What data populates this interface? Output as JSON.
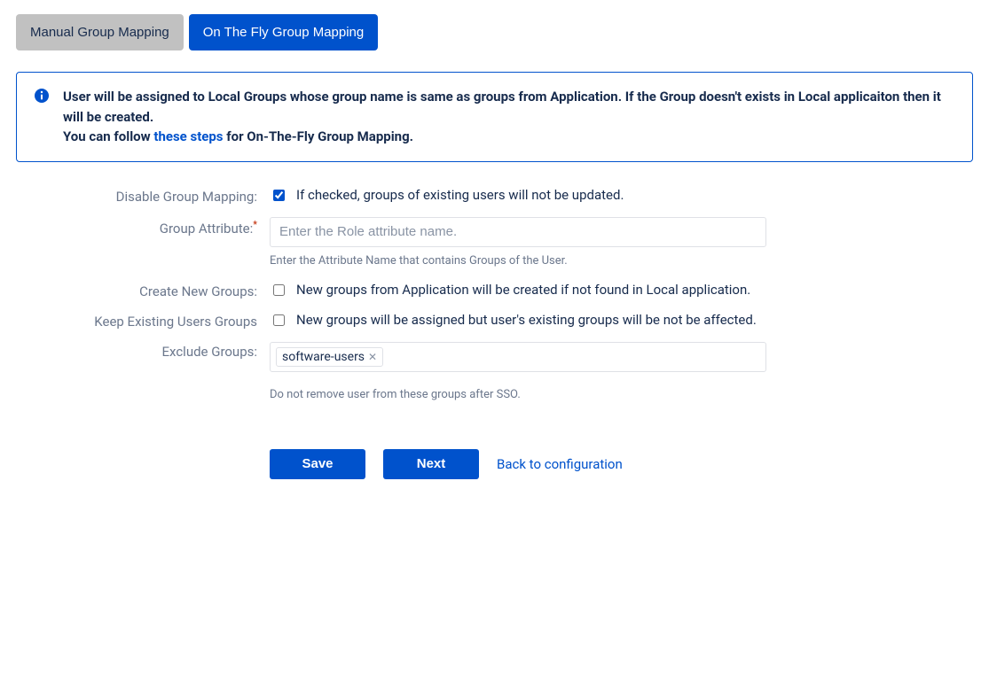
{
  "tabs": {
    "manual": "Manual Group Mapping",
    "onfly": "On The Fly Group Mapping"
  },
  "info": {
    "line1": "User will be assigned to Local Groups whose group name is same as groups from Application. If the Group doesn't exists in Local applicaiton then it will be created.",
    "line2_prefix": "You can follow ",
    "line2_link": "these steps",
    "line2_suffix": " for On-The-Fly Group Mapping."
  },
  "form": {
    "disable_label": "Disable Group Mapping:",
    "disable_desc": "If checked, groups of existing users will not be updated.",
    "group_attr_label": "Group Attribute:",
    "group_attr_placeholder": "Enter the Role attribute name.",
    "group_attr_help": "Enter the Attribute Name that contains Groups of the User.",
    "create_label": "Create New Groups:",
    "create_desc": "New groups from Application will be created if not found in Local application.",
    "keep_label": "Keep Existing Users Groups",
    "keep_desc": "New groups will be assigned but user's existing groups will be not be affected.",
    "exclude_label": "Exclude Groups:",
    "exclude_tag": "software-users",
    "exclude_help": "Do not remove user from these groups after SSO."
  },
  "actions": {
    "save": "Save",
    "next": "Next",
    "back": "Back to configuration"
  }
}
